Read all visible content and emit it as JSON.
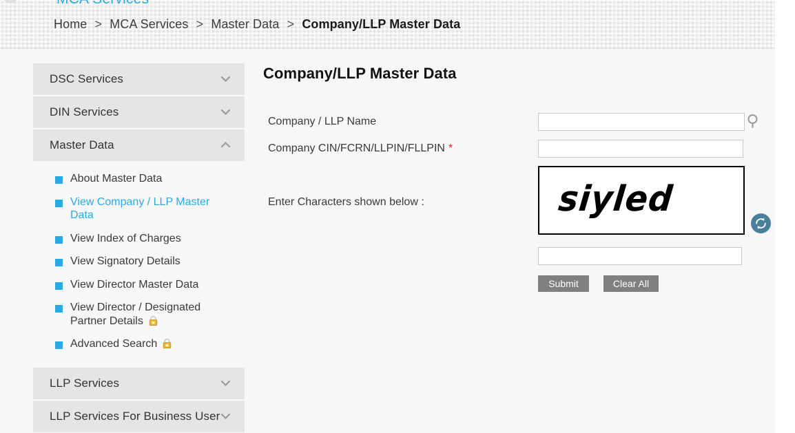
{
  "top_nav_clipped_text": "MCA Services",
  "breadcrumb": {
    "items": [
      {
        "label": "Home",
        "current": false
      },
      {
        "label": "MCA Services",
        "current": false
      },
      {
        "label": "Master Data",
        "current": false
      },
      {
        "label": "Company/LLP Master Data",
        "current": true
      }
    ],
    "separator": ">"
  },
  "sidebar": {
    "sections": [
      {
        "label": "DSC Services",
        "expanded": false,
        "chevron": "chevron-down-icon"
      },
      {
        "label": "DIN Services",
        "expanded": false,
        "chevron": "chevron-down-icon"
      },
      {
        "label": "Master Data",
        "expanded": true,
        "chevron": "chevron-up-icon"
      }
    ],
    "master_data_items": [
      {
        "label": "About Master Data",
        "active": false,
        "locked": false
      },
      {
        "label": "View Company / LLP Master Data",
        "active": true,
        "locked": false
      },
      {
        "label": "View Index of Charges",
        "active": false,
        "locked": false
      },
      {
        "label": "View Signatory Details",
        "active": false,
        "locked": false
      },
      {
        "label": "View Director Master Data",
        "active": false,
        "locked": false
      },
      {
        "label": "View Director / Designated Partner Details",
        "active": false,
        "locked": true
      },
      {
        "label": "Advanced Search",
        "active": false,
        "locked": true
      }
    ],
    "bottom_sections": [
      {
        "label": "LLP Services",
        "expanded": false,
        "chevron": "chevron-down-icon"
      },
      {
        "label": "LLP Services For Business User",
        "expanded": false,
        "chevron": "chevron-down-icon"
      }
    ]
  },
  "main": {
    "title": "Company/LLP Master Data",
    "fields": {
      "company_name": {
        "label": "Company / LLP Name",
        "value": "",
        "placeholder": "",
        "required": false
      },
      "company_cin": {
        "label": "Company CIN/FCRN/LLPIN/FLLPIN",
        "value": "",
        "placeholder": "",
        "required": true,
        "required_mark": "*"
      },
      "captcha_entry": {
        "label": "Enter Characters shown below :",
        "value": "",
        "placeholder": ""
      }
    },
    "captcha": {
      "text": "siyled",
      "refresh_icon": "refresh-icon"
    },
    "search_icon": "search-icon",
    "buttons": {
      "submit": "Submit",
      "clear_all": "Clear All"
    }
  },
  "colors": {
    "accent_blue": "#29abe2",
    "required_red": "#e01b1b",
    "button_grey": "#808080",
    "panel_grey": "#e5e5e5",
    "page_bg": "#f7f7f7",
    "refresh_teal": "#4a7f9b",
    "lock_gold": "#e8b730"
  }
}
